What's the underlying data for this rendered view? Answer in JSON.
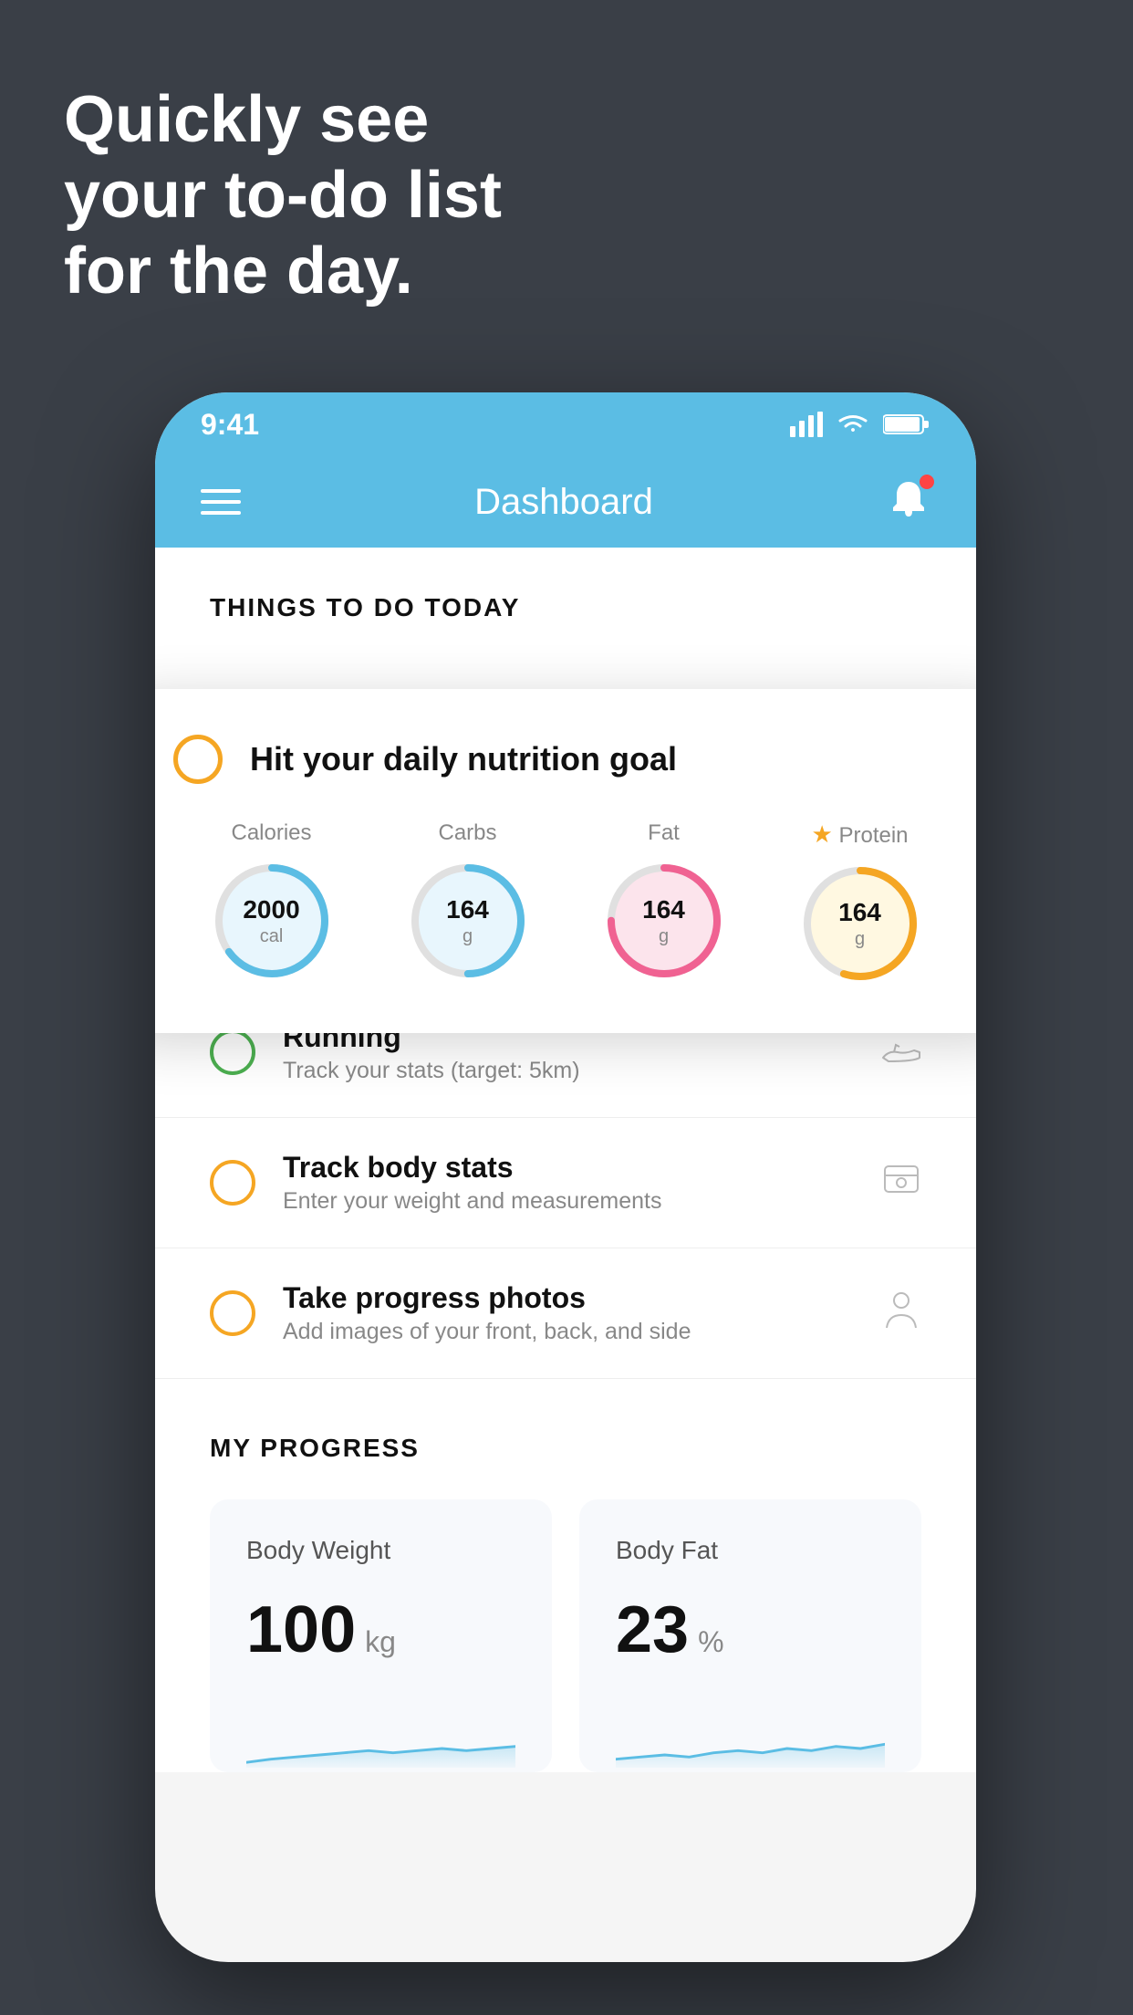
{
  "hero": {
    "line1": "Quickly see",
    "line2": "your to-do list",
    "line3": "for the day."
  },
  "status_bar": {
    "time": "9:41"
  },
  "nav": {
    "title": "Dashboard"
  },
  "things_to_do": {
    "section_title": "THINGS TO DO TODAY"
  },
  "nutrition_card": {
    "checkbox_color": "#f5a623",
    "title": "Hit your daily nutrition goal",
    "items": [
      {
        "label": "Calories",
        "value": "2000",
        "unit": "cal",
        "color": "#5bbde4",
        "bg_color": "#e8f6fd",
        "progress": 65
      },
      {
        "label": "Carbs",
        "value": "164",
        "unit": "g",
        "color": "#5bbde4",
        "bg_color": "#e8f6fd",
        "progress": 50
      },
      {
        "label": "Fat",
        "value": "164",
        "unit": "g",
        "color": "#f06292",
        "bg_color": "#fce4ec",
        "progress": 75
      },
      {
        "label": "Protein",
        "value": "164",
        "unit": "g",
        "color": "#f5a623",
        "bg_color": "#fff8e1",
        "progress": 55,
        "starred": true
      }
    ]
  },
  "todo_items": [
    {
      "title": "Running",
      "subtitle": "Track your stats (target: 5km)",
      "circle_color": "#4caf50",
      "icon": "shoe"
    },
    {
      "title": "Track body stats",
      "subtitle": "Enter your weight and measurements",
      "circle_color": "#f5a623",
      "icon": "scale"
    },
    {
      "title": "Take progress photos",
      "subtitle": "Add images of your front, back, and side",
      "circle_color": "#f5a623",
      "icon": "person"
    }
  ],
  "my_progress": {
    "section_title": "MY PROGRESS",
    "cards": [
      {
        "title": "Body Weight",
        "value": "100",
        "unit": "kg"
      },
      {
        "title": "Body Fat",
        "value": "23",
        "unit": "%"
      }
    ]
  }
}
